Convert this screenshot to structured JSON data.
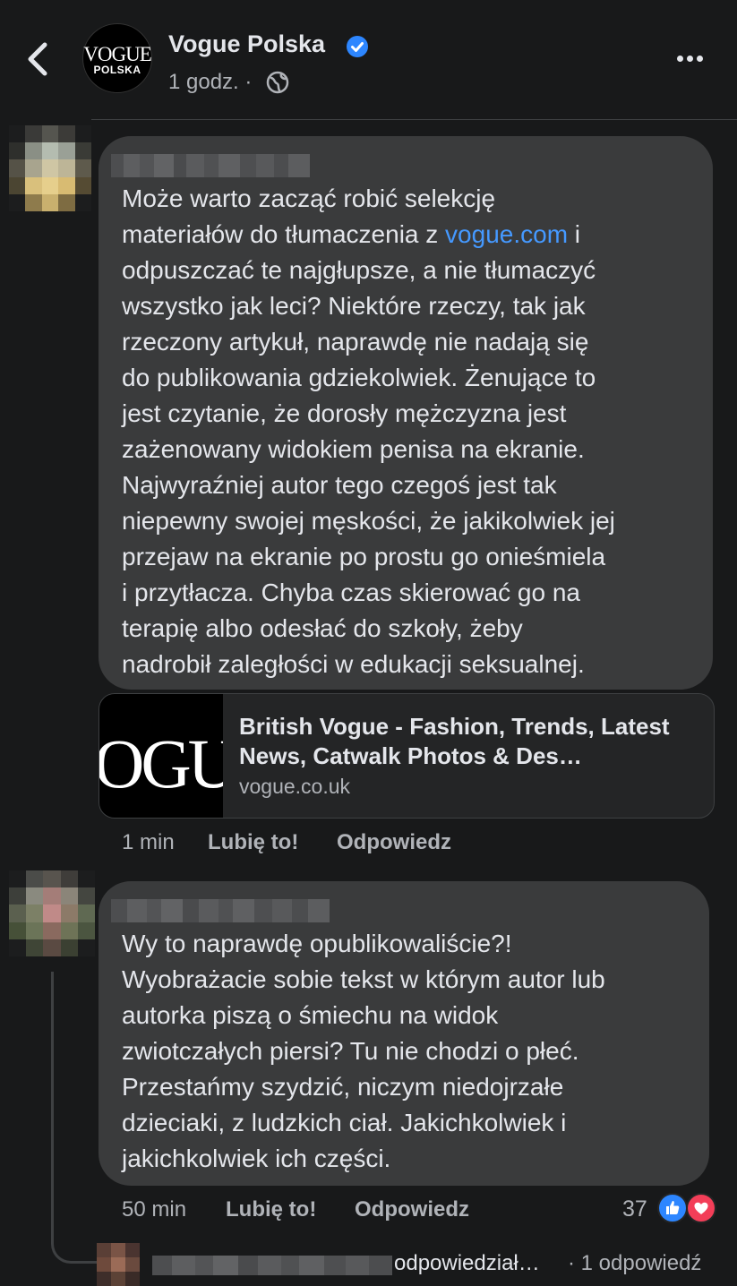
{
  "header": {
    "page_name": "Vogue Polska",
    "logo_line1": "VOGUE",
    "logo_line2": "POLSKA",
    "time": "1 godz. ·",
    "icons": {
      "back": "chevron-left-icon",
      "verified": "verified-badge-icon",
      "audience": "globe-icon",
      "more": "more-options-icon"
    },
    "accent_color": "#2d86ff"
  },
  "comments": [
    {
      "text_before_link": "Może warto zacząć robić selekcję\nmateriałów do tłumaczenia z ",
      "link_text": "vogue.com",
      "text_after_link": " i\nodpuszczać te najgłupsze, a nie tłumaczyć\nwszystko jak leci? Niektóre rzeczy, tak jak\nrzeczony artykuł, naprawdę nie nadają się\ndo publikowania gdziekolwiek.  Żenujące to\njest czytanie, że dorosły mężczyzna jest\nzażenowany widokiem penisa na ekranie.\nNajwyraźniej autor tego czegoś jest tak\nniepewny swojej męskości, że jakikolwiek jej\nprzejaw na ekranie po prostu go onieśmiela\ni przytłacza. Chyba czas skierować go na\nterapię albo odesłać do szkoły, żeby\nnadrobił zaległości w edukacji seksualnej.",
      "preview": {
        "image_text": "OGU",
        "title": "British Vogue - Fashion, Trends, Latest News, Catwalk Photos & Des…",
        "domain": "vogue.co.uk"
      },
      "time": "1 min",
      "like_label": "Lubię to!",
      "reply_label": "Odpowiedz"
    },
    {
      "text": "Wy to naprawdę opublikowaliście?!\nWyobrażacie sobie tekst w którym autor lub\nautorka piszą o śmiechu na widok\nzwiotczałych piersi? Tu nie chodzi o płeć.\nPrzestańmy szydzić, niczym niedojrzałe\ndzieciaki, z ludzkich ciał. Jakichkolwiek i\njakichkolwiek ich części.",
      "time": "50 min",
      "like_label": "Lubię to!",
      "reply_label": "Odpowiedz",
      "reaction_count": "37",
      "reaction_icons": [
        "like-reaction-icon",
        "love-reaction-icon"
      ],
      "reply_summary": {
        "text": "odpowiedział…",
        "count": "· 1 odpowiedź"
      }
    }
  ]
}
